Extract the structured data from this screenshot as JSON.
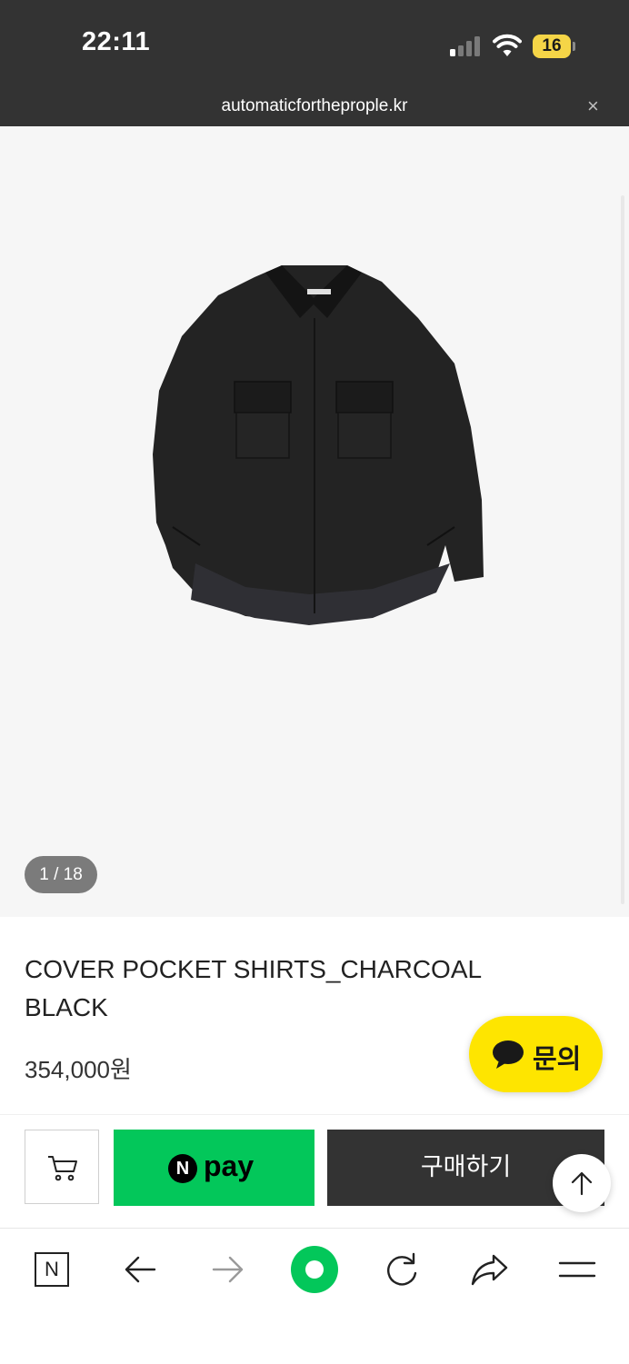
{
  "status_bar": {
    "time": "22:11",
    "battery": "16",
    "icons": [
      "cellular-signal-icon",
      "wifi-icon",
      "battery-icon"
    ]
  },
  "browser": {
    "url": "automaticfortheprople.kr",
    "close_label": "×"
  },
  "product": {
    "image_counter": "1 / 18",
    "title": "COVER POCKET SHIRTS_CHARCOAL BLACK",
    "price": "354,000원"
  },
  "inquiry_button": {
    "label": "문의",
    "color": "#fee500"
  },
  "actions": {
    "npay_badge": "N",
    "npay_label": "pay",
    "buy_label": "구매하기",
    "npay_color": "#03c75a",
    "buy_color": "#333333"
  },
  "toolbar": {
    "home_label": "N",
    "icons": [
      "naver-home-icon",
      "back-arrow-icon",
      "forward-arrow-icon",
      "green-dot-icon",
      "reload-icon",
      "share-icon",
      "menu-icon"
    ]
  }
}
